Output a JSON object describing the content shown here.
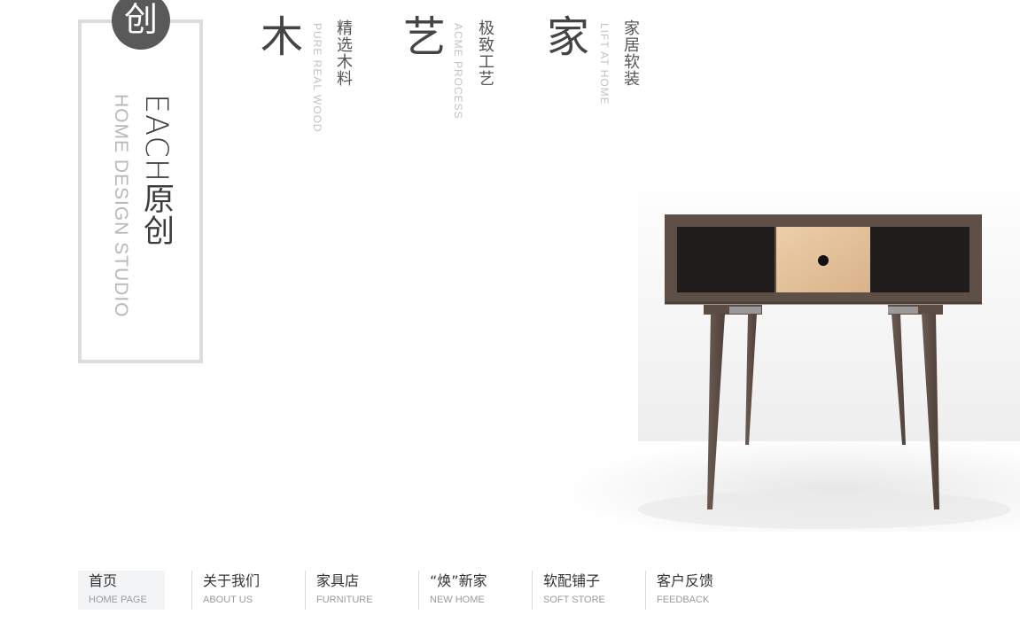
{
  "brand": {
    "circle_char": "创",
    "title": "EACH原创",
    "subtitle": "HOME DESIGN STUDIO"
  },
  "features": [
    {
      "char": "木",
      "en": "PURE REAL WOOD",
      "cn": "精选木料"
    },
    {
      "char": "艺",
      "en": "ACME PROCESS",
      "cn": "极致工艺"
    },
    {
      "char": "家",
      "en": "LIFT AT HOME",
      "cn": "家居软装"
    }
  ],
  "nav": {
    "items": [
      {
        "cn": "首页",
        "en": "HOME PAGE"
      },
      {
        "cn": "关于我们",
        "en": "ABOUT US"
      },
      {
        "cn": "家具店",
        "en": "FURNITURE"
      },
      {
        "cn": "“焕”新家",
        "en": "NEW HOME"
      },
      {
        "cn": "软配铺子",
        "en": "SOFT STORE"
      },
      {
        "cn": "客户反馈",
        "en": "FEEDBACK"
      }
    ]
  },
  "colors": {
    "frame": "#dcdcdc",
    "circle": "#595959",
    "wood_dark": "#5e4f47",
    "wood_light": "#e9c9a1",
    "nav_active_bg": "#f3f4f6"
  }
}
